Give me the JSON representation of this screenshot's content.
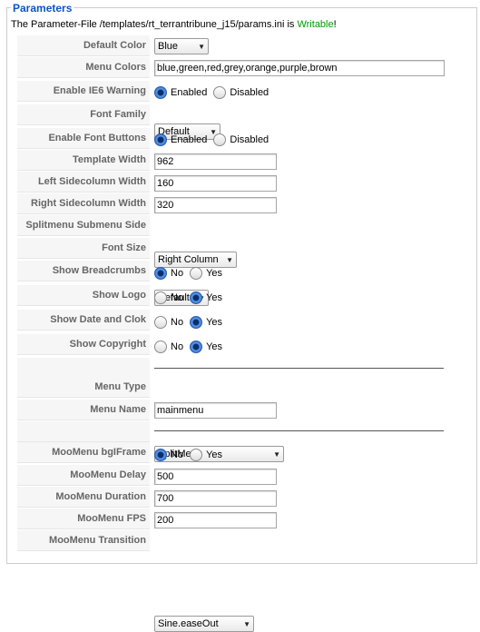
{
  "legend": "Parameters",
  "status": {
    "prefix": "The Parameter-File /templates/rt_terrantribune_j15/params.ini is ",
    "state": "Writable",
    "suffix": "!"
  },
  "fields": {
    "default_color": {
      "label": "Default Color",
      "value": "Blue"
    },
    "menu_colors": {
      "label": "Menu Colors",
      "value": "blue,green,red,grey,orange,purple,brown"
    },
    "ie6_warning": {
      "label": "Enable IE6 Warning",
      "opt1": "Enabled",
      "opt2": "Disabled"
    },
    "font_family": {
      "label": "Font Family",
      "value": "Default"
    },
    "font_buttons": {
      "label": "Enable Font Buttons",
      "opt1": "Enabled",
      "opt2": "Disabled"
    },
    "template_width": {
      "label": "Template Width",
      "value": "962"
    },
    "left_sidecolumn": {
      "label": "Left Sidecolumn Width",
      "value": "160"
    },
    "right_sidecolumn": {
      "label": "Right Sidecolumn Width",
      "value": "320"
    },
    "splitmenu_side": {
      "label": "Splitmenu Submenu Side",
      "value": "Right Column"
    },
    "font_size": {
      "label": "Font Size",
      "value": "Default"
    },
    "show_breadcrumbs": {
      "label": "Show Breadcrumbs",
      "opt1": "No",
      "opt2": "Yes"
    },
    "show_logo": {
      "label": "Show Logo",
      "opt1": "No",
      "opt2": "Yes"
    },
    "show_date": {
      "label": "Show Date and Clok",
      "opt1": "No",
      "opt2": "Yes"
    },
    "show_copyright": {
      "label": "Show Copyright",
      "opt1": "No",
      "opt2": "Yes"
    },
    "menu_type": {
      "label": "Menu Type",
      "value": "SplitMenu"
    },
    "menu_name": {
      "label": "Menu Name",
      "value": "mainmenu"
    },
    "moomenu_bgiframe": {
      "label": "MooMenu bgIFrame",
      "opt1": "No",
      "opt2": "Yes"
    },
    "moomenu_delay": {
      "label": "MooMenu Delay",
      "value": "500"
    },
    "moomenu_duration": {
      "label": "MooMenu Duration",
      "value": "700"
    },
    "moomenu_fps": {
      "label": "MooMenu FPS",
      "value": "200"
    },
    "moomenu_transition": {
      "label": "MooMenu Transition",
      "value": "Sine.easeOut"
    }
  },
  "icons": {
    "radio_checked": "radio-checked-icon",
    "radio_unchecked": "radio-unchecked-icon",
    "dropdown": "dropdown-arrow-icon"
  }
}
